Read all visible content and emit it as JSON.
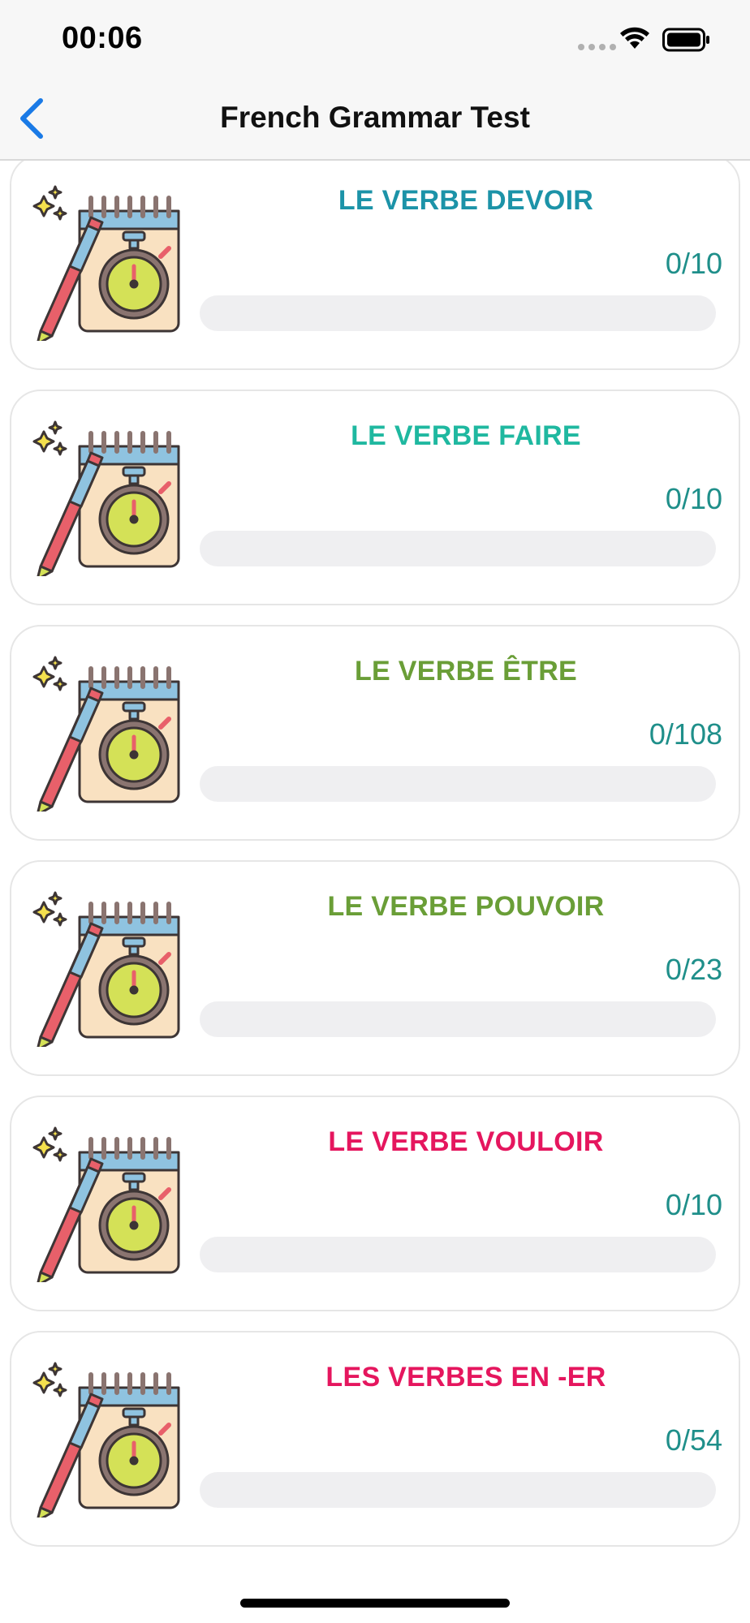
{
  "status_bar": {
    "time": "00:06"
  },
  "nav": {
    "title": "French Grammar Test",
    "back_icon": "chevron-left-icon"
  },
  "colors": {
    "teal": "#1c93a8",
    "aqua": "#1fb8a0",
    "green": "#6a9e37",
    "pink": "#e5165e",
    "score": "#1f8f8a",
    "accent": "#1a7ae6"
  },
  "quizzes": [
    {
      "title": "LE VERBE DEVOIR",
      "score": "0/10",
      "progress": 0,
      "color": "#1c93a8",
      "icon": "notepad-stopwatch-icon"
    },
    {
      "title": "LE VERBE FAIRE",
      "score": "0/10",
      "progress": 0,
      "color": "#1fb8a0",
      "icon": "notepad-stopwatch-icon"
    },
    {
      "title": "LE VERBE ÊTRE",
      "score": "0/108",
      "progress": 0,
      "color": "#6a9e37",
      "icon": "notepad-stopwatch-icon"
    },
    {
      "title": "LE VERBE POUVOIR",
      "score": "0/23",
      "progress": 0,
      "color": "#6a9e37",
      "icon": "notepad-stopwatch-icon"
    },
    {
      "title": "LE VERBE VOULOIR",
      "score": "0/10",
      "progress": 0,
      "color": "#e5165e",
      "icon": "notepad-stopwatch-icon"
    },
    {
      "title": "LES VERBES EN -ER",
      "score": "0/54",
      "progress": 0,
      "color": "#e5165e",
      "icon": "notepad-stopwatch-icon"
    }
  ]
}
